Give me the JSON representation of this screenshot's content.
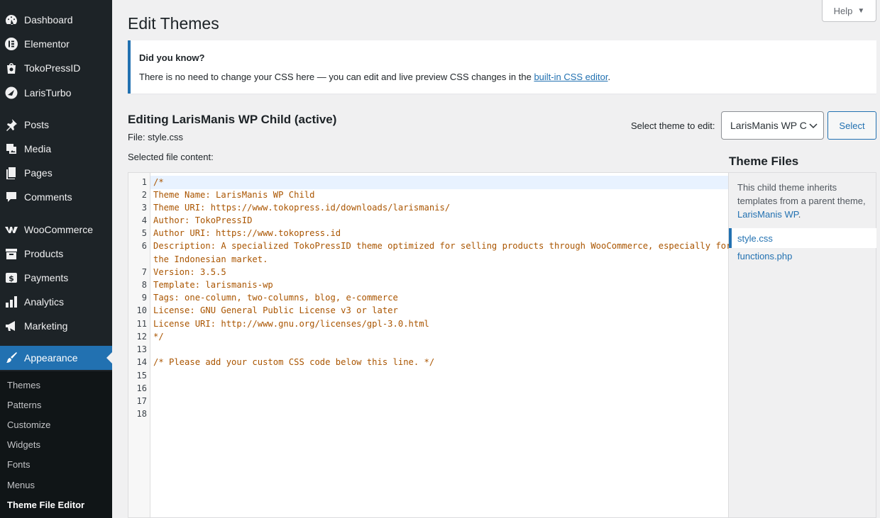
{
  "sidebar": {
    "items": [
      {
        "label": "Dashboard",
        "icon": "dashboard-icon"
      },
      {
        "label": "Elementor",
        "icon": "elementor-icon"
      },
      {
        "label": "TokoPressID",
        "icon": "tokopress-icon"
      },
      {
        "label": "LarisTurbo",
        "icon": "laristurbo-icon"
      },
      {
        "label": "Posts",
        "icon": "pin-icon"
      },
      {
        "label": "Media",
        "icon": "media-icon"
      },
      {
        "label": "Pages",
        "icon": "pages-icon"
      },
      {
        "label": "Comments",
        "icon": "comment-icon"
      },
      {
        "label": "WooCommerce",
        "icon": "woocommerce-icon"
      },
      {
        "label": "Products",
        "icon": "archive-icon"
      },
      {
        "label": "Payments",
        "icon": "payments-icon"
      },
      {
        "label": "Analytics",
        "icon": "bar-chart-icon"
      },
      {
        "label": "Marketing",
        "icon": "megaphone-icon"
      },
      {
        "label": "Appearance",
        "icon": "paintbrush-icon"
      }
    ],
    "submenu": [
      "Themes",
      "Patterns",
      "Customize",
      "Widgets",
      "Fonts",
      "Menus",
      "Theme File Editor"
    ]
  },
  "header": {
    "help_label": "Help",
    "help_arrow": "▼",
    "title": "Edit Themes"
  },
  "notice": {
    "title": "Did you know?",
    "text_before": "There is no need to change your CSS here — you can edit and live preview CSS changes in the ",
    "link": "built-in CSS editor",
    "text_after": "."
  },
  "editing": {
    "title": "Editing LarisManis WP Child (active)",
    "file_label": "File: style.css",
    "content_label": "Selected file content:"
  },
  "theme_select": {
    "label": "Select theme to edit:",
    "value": "LarisManis WP Child",
    "button": "Select"
  },
  "editor": {
    "line_numbers": [
      "1",
      "2",
      "3",
      "4",
      "5",
      "6",
      "7",
      "8",
      "9",
      "10",
      "11",
      "12",
      "13",
      "14",
      "15",
      "16",
      "17",
      "18"
    ],
    "lines": [
      "/*",
      "Theme Name: LarisManis WP Child",
      "Theme URI: https://www.tokopress.id/downloads/larismanis/",
      "Author: TokoPressID",
      "Author URI: https://www.tokopress.id",
      "Description: A specialized TokoPressID theme optimized for selling products through WooCommerce, especially for",
      "the Indonesian market.",
      "Version: 3.5.5",
      "Template: larismanis-wp",
      "Tags: one-column, two-columns, blog, e-commerce",
      "License: GNU General Public License v3 or later",
      "License URI: http://www.gnu.org/licenses/gpl-3.0.html",
      "*/",
      "/* Please add your custom CSS code below this line. */"
    ]
  },
  "theme_files": {
    "title": "Theme Files",
    "desc": "This child theme inherits templates from a parent theme, ",
    "parent_link": "LarisManis WP",
    "desc_end": ".",
    "files": [
      "style.css",
      "functions.php"
    ]
  },
  "colors": {
    "sidebar_bg": "#1d2327",
    "accent": "#2271b1",
    "code_text": "#aa5500"
  }
}
